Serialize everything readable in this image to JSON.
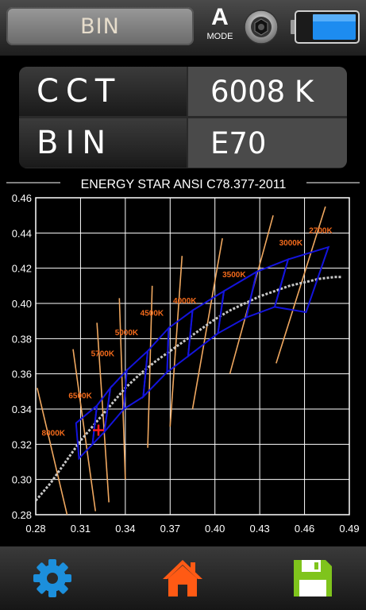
{
  "header": {
    "mode_label": "BIN",
    "mode_button_letter": "A",
    "mode_button_caption": "MODE",
    "shutter_icon": "shutter-icon",
    "battery_icon": "battery-icon"
  },
  "readout": {
    "rows": [
      {
        "label": "CCT",
        "value": "6008 K"
      },
      {
        "label": "BIN",
        "value": "E70"
      }
    ]
  },
  "chart_data": {
    "type": "scatter",
    "title": "ENERGY STAR ANSI C78.377-2011",
    "xlim": [
      0.28,
      0.49
    ],
    "ylim": [
      0.28,
      0.46
    ],
    "x_ticks": [
      "0.28",
      "0.31",
      "0.34",
      "0.37",
      "0.40",
      "0.43",
      "0.46",
      "0.49"
    ],
    "y_ticks": [
      "0.46",
      "0.44",
      "0.42",
      "0.40",
      "0.38",
      "0.36",
      "0.34",
      "0.32",
      "0.30",
      "0.28"
    ],
    "grid": true,
    "cct_labels": [
      {
        "text": "8000K",
        "x": 0.284,
        "y": 0.325
      },
      {
        "text": "6500K",
        "x": 0.302,
        "y": 0.346
      },
      {
        "text": "5700K",
        "x": 0.317,
        "y": 0.37
      },
      {
        "text": "5000K",
        "x": 0.333,
        "y": 0.382
      },
      {
        "text": "4500K",
        "x": 0.35,
        "y": 0.393
      },
      {
        "text": "4000K",
        "x": 0.372,
        "y": 0.4
      },
      {
        "text": "3500K",
        "x": 0.405,
        "y": 0.415
      },
      {
        "text": "3000K",
        "x": 0.443,
        "y": 0.433
      },
      {
        "text": "2700K",
        "x": 0.463,
        "y": 0.44
      }
    ],
    "cct_lines": [
      [
        [
          0.281,
          0.352
        ],
        [
          0.301,
          0.28
        ]
      ],
      [
        [
          0.305,
          0.374
        ],
        [
          0.32,
          0.282
        ]
      ],
      [
        [
          0.321,
          0.389
        ],
        [
          0.329,
          0.287
        ]
      ],
      [
        [
          0.336,
          0.403
        ],
        [
          0.34,
          0.3
        ]
      ],
      [
        [
          0.358,
          0.41
        ],
        [
          0.355,
          0.318
        ]
      ],
      [
        [
          0.378,
          0.427
        ],
        [
          0.37,
          0.33
        ]
      ],
      [
        [
          0.405,
          0.437
        ],
        [
          0.385,
          0.34
        ]
      ],
      [
        [
          0.439,
          0.45
        ],
        [
          0.41,
          0.36
        ]
      ],
      [
        [
          0.474,
          0.455
        ],
        [
          0.441,
          0.366
        ]
      ]
    ],
    "planckian_locus": [
      [
        0.28,
        0.288
      ],
      [
        0.29,
        0.298
      ],
      [
        0.3,
        0.31
      ],
      [
        0.31,
        0.322
      ],
      [
        0.32,
        0.332
      ],
      [
        0.33,
        0.342
      ],
      [
        0.34,
        0.352
      ],
      [
        0.35,
        0.36
      ],
      [
        0.36,
        0.367
      ],
      [
        0.37,
        0.373
      ],
      [
        0.38,
        0.379
      ],
      [
        0.39,
        0.385
      ],
      [
        0.4,
        0.391
      ],
      [
        0.41,
        0.396
      ],
      [
        0.42,
        0.4
      ],
      [
        0.43,
        0.404
      ],
      [
        0.44,
        0.407
      ],
      [
        0.45,
        0.41
      ],
      [
        0.46,
        0.412
      ],
      [
        0.47,
        0.414
      ],
      [
        0.48,
        0.415
      ],
      [
        0.485,
        0.415
      ]
    ],
    "bin_quadrangles": [
      [
        [
          0.307,
          0.332
        ],
        [
          0.321,
          0.342
        ],
        [
          0.318,
          0.32
        ],
        [
          0.309,
          0.312
        ]
      ],
      [
        [
          0.321,
          0.342
        ],
        [
          0.33,
          0.352
        ],
        [
          0.326,
          0.327
        ],
        [
          0.318,
          0.32
        ]
      ],
      [
        [
          0.33,
          0.352
        ],
        [
          0.341,
          0.362
        ],
        [
          0.339,
          0.34
        ],
        [
          0.326,
          0.327
        ]
      ],
      [
        [
          0.341,
          0.362
        ],
        [
          0.355,
          0.373
        ],
        [
          0.352,
          0.347
        ],
        [
          0.339,
          0.34
        ]
      ],
      [
        [
          0.355,
          0.373
        ],
        [
          0.369,
          0.386
        ],
        [
          0.368,
          0.361
        ],
        [
          0.352,
          0.347
        ]
      ],
      [
        [
          0.369,
          0.386
        ],
        [
          0.385,
          0.396
        ],
        [
          0.382,
          0.37
        ],
        [
          0.368,
          0.361
        ]
      ],
      [
        [
          0.385,
          0.396
        ],
        [
          0.406,
          0.407
        ],
        [
          0.402,
          0.383
        ],
        [
          0.382,
          0.37
        ]
      ],
      [
        [
          0.406,
          0.407
        ],
        [
          0.428,
          0.418
        ],
        [
          0.421,
          0.392
        ],
        [
          0.402,
          0.383
        ]
      ],
      [
        [
          0.428,
          0.418
        ],
        [
          0.449,
          0.425
        ],
        [
          0.44,
          0.398
        ],
        [
          0.421,
          0.392
        ]
      ],
      [
        [
          0.449,
          0.425
        ],
        [
          0.476,
          0.432
        ],
        [
          0.461,
          0.395
        ],
        [
          0.44,
          0.398
        ]
      ]
    ],
    "measured_point": {
      "x": 0.322,
      "y": 0.328
    },
    "colors": {
      "grid": "#ffffff",
      "cct_lines": "#f0a860",
      "cct_labels": "#f26a1b",
      "bins": "#1414dc",
      "locus": "#c8c8c8",
      "marker": "#ff1e1e"
    }
  },
  "footer": {
    "settings_icon": "gear-icon",
    "home_icon": "home-icon",
    "save_icon": "save-icon"
  }
}
